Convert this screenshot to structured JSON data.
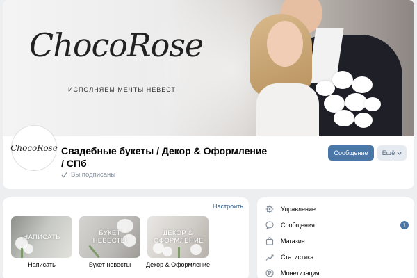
{
  "cover": {
    "logo_text": "ChocoRose",
    "tagline": "ИСПОЛНЯЕМ МЕЧТЫ НЕВЕСТ"
  },
  "group": {
    "avatar_text": "ChocoRose",
    "title": "Свадебные букеты / Декор & Оформление / СПб",
    "subscribed_label": "Вы подписаны",
    "message_button": "Сообщение",
    "more_button": "Ещё"
  },
  "menu": {
    "customize_label": "Настроить",
    "tiles": [
      {
        "tile_text": "НАПИСАТЬ",
        "caption": "Написать"
      },
      {
        "tile_text": "БУКЕТ НЕВЕСТЫ",
        "caption": "Букет невесты"
      },
      {
        "tile_text": "ДЕКОР & ОФОРМЛЕНИЕ",
        "caption": "Декор & Оформление"
      }
    ]
  },
  "admin": {
    "items": [
      {
        "label": "Управление",
        "icon": "gear-icon"
      },
      {
        "label": "Сообщения",
        "icon": "chat-icon",
        "badge": "1"
      },
      {
        "label": "Магазин",
        "icon": "bag-icon"
      },
      {
        "label": "Статистика",
        "icon": "chart-icon"
      },
      {
        "label": "Монетизация",
        "icon": "money-icon"
      }
    ]
  },
  "colors": {
    "accent": "#4a76a8",
    "link": "#2a5885",
    "background": "#edeef0",
    "secondary_button": "#e5ebf1"
  }
}
